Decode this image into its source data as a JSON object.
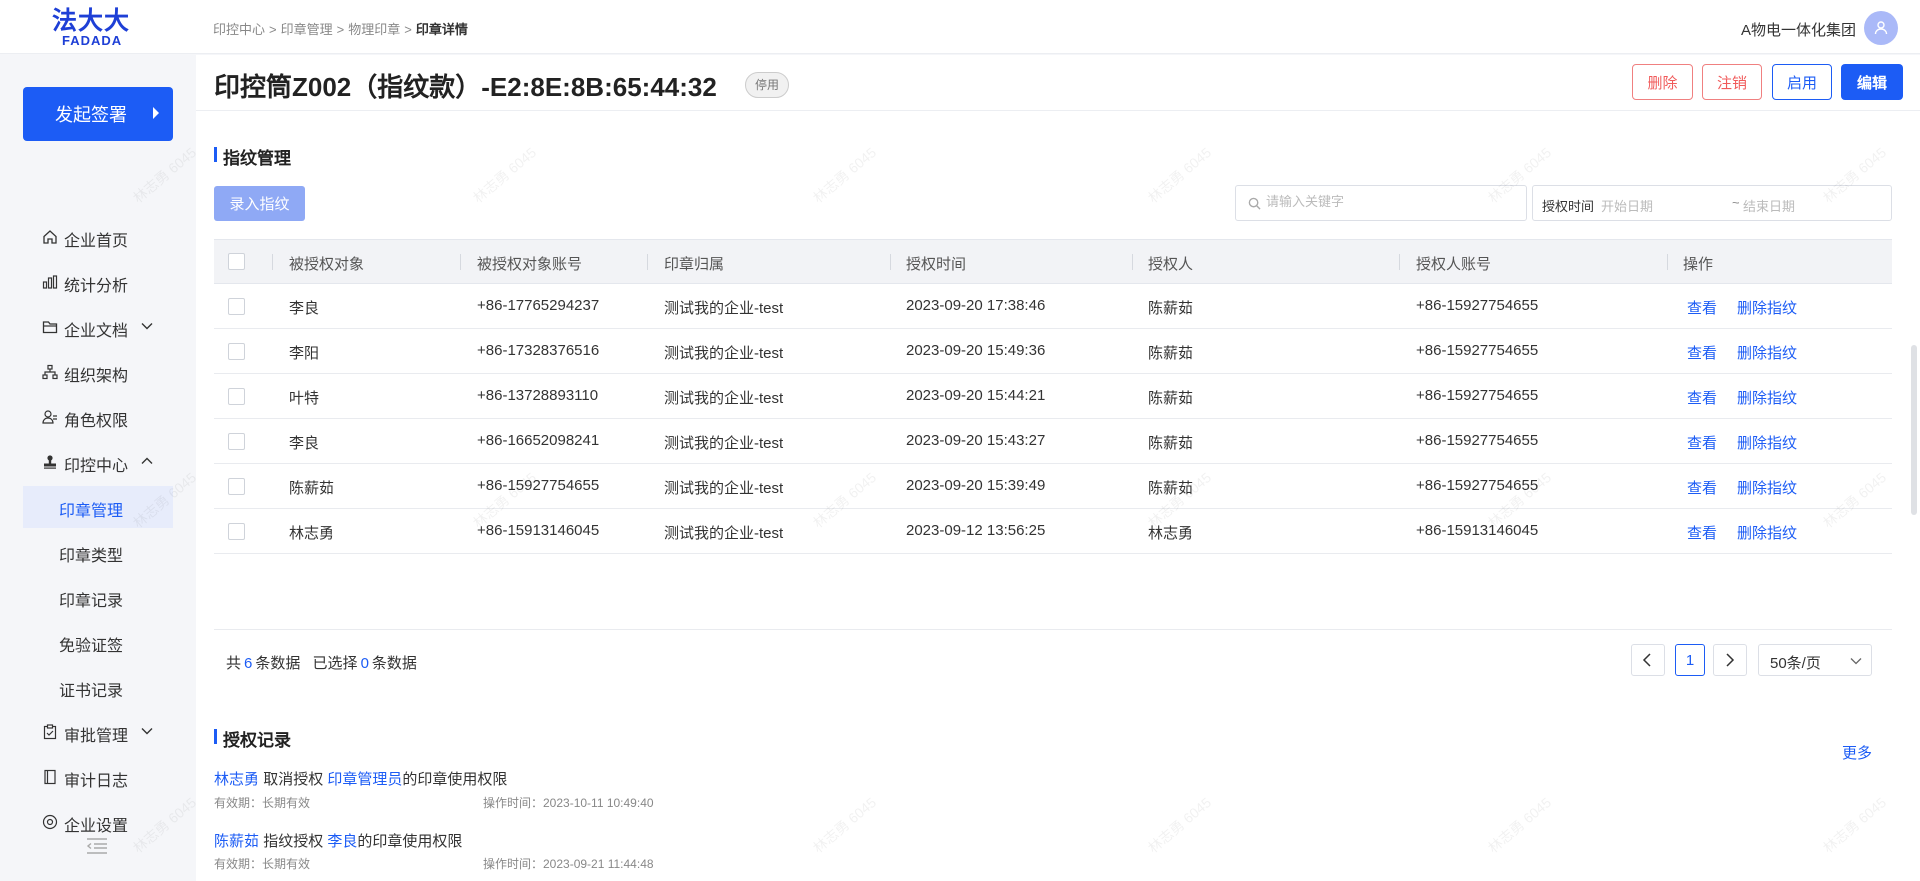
{
  "brand": {
    "logo_cn": "法大大",
    "logo_en": "FADADA"
  },
  "breadcrumb": [
    "印控中心",
    "印章管理",
    "物理印章",
    "印章详情"
  ],
  "header": {
    "org_name": "A物电一体化集团"
  },
  "sidebar": {
    "start_button": "发起签署",
    "items": [
      {
        "label": "企业首页",
        "icon": "home-icon"
      },
      {
        "label": "统计分析",
        "icon": "bar-chart-icon"
      },
      {
        "label": "企业文档",
        "icon": "folder-icon"
      },
      {
        "label": "组织架构",
        "icon": "org-tree-icon"
      },
      {
        "label": "角色权限",
        "icon": "user-role-icon"
      },
      {
        "label": "印控中心",
        "icon": "stamp-icon"
      },
      {
        "label": "审批管理",
        "icon": "clipboard-icon"
      },
      {
        "label": "审计日志",
        "icon": "log-icon"
      },
      {
        "label": "企业设置",
        "icon": "settings-icon"
      }
    ],
    "sub_items": [
      "印章管理",
      "印章类型",
      "印章记录",
      "免验证签",
      "证书记录"
    ]
  },
  "page": {
    "title": "印控筒Z002（指纹款）-E2:8E:8B:65:44:32",
    "status": "停用",
    "buttons": {
      "delete": "删除",
      "cancel": "注销",
      "enable": "启用",
      "edit": "编辑"
    }
  },
  "fingerprint": {
    "section_title": "指纹管理",
    "record_button": "录入指纹",
    "search_placeholder": "请输入关键字",
    "date_label": "授权时间",
    "date_start_placeholder": "开始日期",
    "date_sep": "~",
    "date_end_placeholder": "结束日期",
    "columns": [
      "被授权对象",
      "被授权对象账号",
      "印章归属",
      "授权时间",
      "授权人",
      "授权人账号",
      "操作"
    ],
    "rows": [
      {
        "name": "李良",
        "account": "+86-17765294237",
        "owner": "测试我的企业-test",
        "time": "2023-09-20 17:38:46",
        "grantor": "陈薪茹",
        "grantor_account": "+86-15927754655"
      },
      {
        "name": "李阳",
        "account": "+86-17328376516",
        "owner": "测试我的企业-test",
        "time": "2023-09-20 15:49:36",
        "grantor": "陈薪茹",
        "grantor_account": "+86-15927754655"
      },
      {
        "name": "叶特",
        "account": "+86-13728893110",
        "owner": "测试我的企业-test",
        "time": "2023-09-20 15:44:21",
        "grantor": "陈薪茹",
        "grantor_account": "+86-15927754655"
      },
      {
        "name": "李良",
        "account": "+86-16652098241",
        "owner": "测试我的企业-test",
        "time": "2023-09-20 15:43:27",
        "grantor": "陈薪茹",
        "grantor_account": "+86-15927754655"
      },
      {
        "name": "陈薪茹",
        "account": "+86-15927754655",
        "owner": "测试我的企业-test",
        "time": "2023-09-20 15:39:49",
        "grantor": "陈薪茹",
        "grantor_account": "+86-15927754655"
      },
      {
        "name": "林志勇",
        "account": "+86-15913146045",
        "owner": "测试我的企业-test",
        "time": "2023-09-12 13:56:25",
        "grantor": "林志勇",
        "grantor_account": "+86-15913146045"
      }
    ],
    "action_view": "查看",
    "action_delete": "删除指纹",
    "pagination": {
      "total_prefix": "共",
      "total": "6",
      "total_suffix": "条数据",
      "selected_prefix": "已选择",
      "selected": "0",
      "selected_suffix": "条数据",
      "current_page": "1",
      "page_size": "50条/页"
    }
  },
  "auth_records": {
    "section_title": "授权记录",
    "more": "更多",
    "records": [
      {
        "actor": "林志勇",
        "action": "取消授权",
        "target": "印章管理员",
        "suffix": "的印章使用权限",
        "validity": "有效期：长期有效",
        "op_time": "操作时间：2023-10-11 10:49:40"
      },
      {
        "actor": "陈薪茹",
        "action": "指纹授权",
        "target": "李良",
        "suffix": "的印章使用权限",
        "validity": "有效期：长期有效",
        "op_time": "操作时间：2023-09-21 11:44:48"
      }
    ]
  },
  "watermark": "林志勇 6045",
  "colors": {
    "primary": "#1c5cf5",
    "danger": "#f05a5a",
    "sidebar_bg": "#f5f6f9"
  }
}
